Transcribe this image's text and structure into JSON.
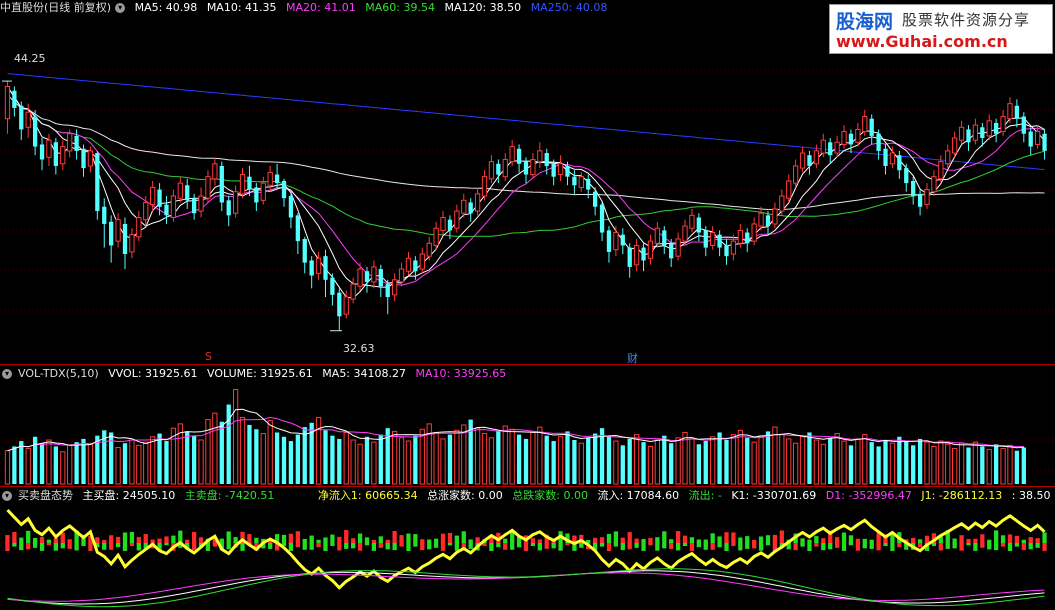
{
  "price_panel": {
    "title": "中直股份(日线 前复权)",
    "ma": [
      {
        "label": "MA5: 40.98",
        "color": "#ffffff"
      },
      {
        "label": "MA10: 41.35",
        "color": "#ffffff"
      },
      {
        "label": "MA20: 41.01",
        "color": "#ff3cff"
      },
      {
        "label": "MA60: 39.54",
        "color": "#33dd33"
      },
      {
        "label": "MA120: 38.50",
        "color": "#ffffff"
      },
      {
        "label": "MA250: 40.08",
        "color": "#3355ff"
      }
    ],
    "high_label": "44.25",
    "low_label": "32.63",
    "marker_s": "S",
    "marker_cai": "财"
  },
  "volume_panel": {
    "title": "VOL-TDX(5,10)",
    "items": [
      {
        "label": "VVOL: 31925.61",
        "color": "#ffffff"
      },
      {
        "label": "VOLUME: 31925.61",
        "color": "#ffffff"
      },
      {
        "label": "MA5: 34108.27",
        "color": "#ffffff"
      },
      {
        "label": "MA10: 33925.65",
        "color": "#ff3cff"
      }
    ]
  },
  "indicator_panel": {
    "title": "买卖盘态势",
    "items": [
      {
        "label": "主买盘: 24505.10",
        "color": "#ffffff"
      },
      {
        "label": "主卖盘: -7420.51",
        "color": "#33dd33"
      },
      {
        "label": "净流入1: 60665.34",
        "color": "#ffff33"
      },
      {
        "label": "总涨家数: 0.00",
        "color": "#ffffff"
      },
      {
        "label": "总跌家数: 0.00",
        "color": "#33dd33"
      },
      {
        "label": "流入: 17084.60",
        "color": "#ffffff"
      },
      {
        "label": "流出: -",
        "color": "#33dd33"
      },
      {
        "label": "K1: -330701.69",
        "color": "#ffffff"
      },
      {
        "label": "D1: -352996.47",
        "color": "#ff3cff"
      },
      {
        "label": "J1: -286112.13",
        "color": "#ffff33"
      },
      {
        "label": ": 38.50",
        "color": "#ffffff"
      }
    ]
  },
  "watermark": {
    "brand": "股海网",
    "slogan": "股票软件资源分享",
    "url": "www.Guhai.com.cn"
  },
  "chart_data": {
    "type": "candlestick",
    "candles": [
      [
        42.5,
        44.0,
        41.8,
        44.25
      ],
      [
        43.8,
        43.0,
        42.6,
        44.0
      ],
      [
        43.1,
        42.0,
        41.5,
        43.3
      ],
      [
        42.1,
        42.8,
        41.6,
        43.2
      ],
      [
        42.6,
        41.2,
        40.8,
        42.9
      ],
      [
        41.3,
        40.6,
        40.1,
        41.6
      ],
      [
        40.7,
        41.5,
        40.3,
        41.8
      ],
      [
        41.4,
        40.3,
        39.9,
        41.6
      ],
      [
        40.4,
        41.2,
        40.1,
        41.5
      ],
      [
        41.0,
        41.8,
        40.7,
        42.0
      ],
      [
        41.7,
        41.0,
        40.6,
        42.0
      ],
      [
        41.1,
        40.2,
        39.8,
        41.3
      ],
      [
        40.3,
        41.0,
        40.0,
        41.2
      ],
      [
        40.9,
        38.2,
        37.8,
        41.0
      ],
      [
        38.4,
        37.6,
        36.5,
        38.8
      ],
      [
        37.7,
        36.6,
        35.8,
        38.0
      ],
      [
        36.8,
        37.8,
        36.5,
        38.1
      ],
      [
        37.6,
        36.2,
        35.5,
        37.9
      ],
      [
        36.3,
        37.1,
        36.0,
        37.4
      ],
      [
        37.0,
        37.9,
        36.8,
        38.2
      ],
      [
        37.8,
        38.6,
        37.5,
        38.9
      ],
      [
        38.5,
        39.3,
        38.2,
        39.6
      ],
      [
        39.2,
        38.4,
        38.0,
        39.5
      ],
      [
        38.5,
        38.0,
        37.6,
        38.9
      ],
      [
        37.9,
        38.9,
        37.7,
        39.2
      ],
      [
        38.8,
        39.5,
        38.6,
        39.8
      ],
      [
        39.4,
        38.7,
        38.3,
        39.7
      ],
      [
        38.8,
        38.1,
        37.8,
        39.0
      ],
      [
        38.2,
        38.9,
        37.9,
        39.3
      ],
      [
        38.8,
        39.8,
        38.6,
        40.1
      ],
      [
        39.7,
        40.4,
        39.4,
        40.7
      ],
      [
        40.3,
        38.6,
        38.2,
        40.5
      ],
      [
        38.7,
        38.0,
        37.5,
        38.9
      ],
      [
        38.1,
        39.1,
        37.9,
        39.4
      ],
      [
        39.0,
        39.9,
        38.8,
        40.2
      ],
      [
        39.8,
        39.2,
        38.9,
        40.3
      ],
      [
        39.3,
        38.6,
        38.2,
        39.5
      ],
      [
        38.7,
        39.5,
        38.5,
        39.8
      ],
      [
        39.4,
        40.0,
        39.1,
        40.3
      ],
      [
        39.9,
        39.5,
        39.2,
        40.4
      ],
      [
        39.6,
        38.8,
        38.4,
        39.7
      ],
      [
        38.9,
        37.9,
        37.4,
        39.0
      ],
      [
        38.0,
        36.8,
        36.2,
        38.1
      ],
      [
        36.9,
        35.8,
        35.3,
        37.0
      ],
      [
        35.9,
        35.2,
        34.6,
        36.1
      ],
      [
        35.3,
        36.0,
        35.0,
        36.3
      ],
      [
        36.1,
        35.0,
        34.2,
        36.4
      ],
      [
        35.1,
        34.3,
        33.8,
        35.3
      ],
      [
        34.4,
        33.3,
        32.63,
        34.6
      ],
      [
        33.4,
        34.2,
        33.2,
        34.5
      ],
      [
        34.1,
        34.8,
        33.9,
        35.1
      ],
      [
        34.7,
        35.5,
        34.5,
        35.8
      ],
      [
        35.4,
        34.9,
        34.4,
        35.6
      ],
      [
        34.9,
        35.6,
        34.6,
        35.9
      ],
      [
        35.5,
        34.7,
        34.2,
        35.7
      ],
      [
        34.8,
        34.2,
        33.4,
        35.0
      ],
      [
        34.3,
        35.0,
        34.0,
        35.3
      ],
      [
        34.9,
        35.5,
        34.7,
        35.8
      ],
      [
        35.4,
        36.0,
        35.2,
        36.3
      ],
      [
        35.9,
        35.4,
        35.0,
        36.1
      ],
      [
        35.5,
        36.2,
        35.3,
        36.5
      ],
      [
        36.1,
        36.7,
        35.9,
        37.0
      ],
      [
        36.6,
        37.4,
        36.4,
        37.7
      ],
      [
        37.3,
        37.9,
        37.1,
        38.2
      ],
      [
        37.8,
        37.3,
        36.9,
        38.0
      ],
      [
        37.4,
        38.2,
        37.2,
        38.5
      ],
      [
        38.1,
        38.7,
        37.9,
        39.0
      ],
      [
        38.6,
        38.1,
        37.7,
        38.8
      ],
      [
        38.2,
        39.0,
        38.0,
        39.3
      ],
      [
        38.9,
        39.8,
        38.7,
        40.1
      ],
      [
        39.7,
        40.5,
        39.5,
        40.8
      ],
      [
        40.4,
        39.9,
        39.5,
        40.6
      ],
      [
        39.8,
        40.6,
        39.6,
        40.9
      ],
      [
        40.5,
        41.2,
        40.3,
        41.5
      ],
      [
        41.1,
        40.4,
        40.0,
        41.3
      ],
      [
        40.5,
        39.9,
        39.5,
        40.7
      ],
      [
        39.9,
        40.6,
        39.7,
        40.9
      ],
      [
        40.5,
        41.0,
        40.2,
        41.4
      ],
      [
        40.9,
        40.3,
        39.9,
        41.1
      ],
      [
        40.4,
        39.8,
        39.4,
        40.6
      ],
      [
        39.9,
        40.4,
        39.6,
        40.8
      ],
      [
        40.3,
        39.8,
        39.4,
        40.5
      ],
      [
        39.8,
        39.4,
        39.0,
        40.1
      ],
      [
        39.3,
        39.8,
        39.1,
        40.0
      ],
      [
        39.7,
        39.2,
        38.8,
        39.9
      ],
      [
        39.1,
        38.4,
        38.0,
        39.3
      ],
      [
        38.5,
        37.2,
        36.8,
        38.6
      ],
      [
        37.3,
        36.3,
        35.8,
        37.5
      ],
      [
        36.4,
        37.2,
        36.1,
        37.5
      ],
      [
        37.1,
        36.6,
        36.2,
        37.4
      ],
      [
        36.5,
        35.6,
        35.1,
        36.7
      ],
      [
        35.7,
        36.6,
        35.4,
        36.9
      ],
      [
        36.5,
        35.9,
        35.4,
        36.7
      ],
      [
        36.0,
        36.8,
        35.7,
        37.1
      ],
      [
        36.7,
        37.4,
        36.5,
        37.7
      ],
      [
        37.3,
        36.6,
        36.2,
        37.5
      ],
      [
        36.7,
        36.0,
        35.6,
        36.9
      ],
      [
        36.1,
        36.9,
        35.9,
        37.2
      ],
      [
        36.8,
        37.5,
        36.6,
        37.8
      ],
      [
        37.4,
        38.0,
        37.2,
        38.3
      ],
      [
        37.9,
        37.2,
        36.8,
        38.1
      ],
      [
        37.3,
        36.5,
        36.1,
        37.5
      ],
      [
        36.6,
        37.2,
        36.4,
        37.5
      ],
      [
        37.1,
        36.5,
        36.1,
        37.3
      ],
      [
        36.6,
        36.1,
        35.7,
        36.9
      ],
      [
        36.2,
        36.8,
        35.9,
        37.1
      ],
      [
        36.7,
        37.3,
        36.5,
        37.6
      ],
      [
        37.2,
        36.7,
        36.3,
        37.4
      ],
      [
        36.8,
        37.6,
        36.6,
        37.9
      ],
      [
        37.5,
        38.1,
        37.3,
        38.4
      ],
      [
        38.0,
        37.5,
        37.1,
        38.2
      ],
      [
        37.6,
        38.3,
        37.4,
        38.6
      ],
      [
        38.2,
        38.9,
        38.0,
        39.2
      ],
      [
        38.8,
        39.6,
        38.6,
        39.9
      ],
      [
        39.5,
        40.3,
        39.3,
        40.6
      ],
      [
        40.2,
        40.9,
        40.0,
        41.2
      ],
      [
        40.8,
        40.3,
        39.9,
        41.0
      ],
      [
        40.4,
        41.0,
        40.2,
        41.3
      ],
      [
        40.9,
        41.5,
        40.7,
        41.8
      ],
      [
        41.4,
        40.8,
        40.4,
        41.6
      ],
      [
        40.9,
        41.4,
        40.7,
        41.7
      ],
      [
        41.3,
        41.9,
        41.1,
        42.2
      ],
      [
        41.8,
        41.3,
        40.9,
        42.0
      ],
      [
        41.4,
        42.0,
        41.2,
        42.3
      ],
      [
        41.9,
        42.6,
        41.7,
        42.9
      ],
      [
        42.5,
        41.7,
        41.3,
        42.7
      ],
      [
        41.8,
        41.0,
        40.6,
        42.0
      ],
      [
        41.1,
        40.3,
        39.9,
        41.3
      ],
      [
        40.4,
        40.9,
        40.2,
        41.2
      ],
      [
        40.8,
        40.1,
        39.7,
        41.0
      ],
      [
        40.2,
        39.5,
        39.1,
        40.4
      ],
      [
        39.6,
        38.9,
        38.5,
        39.8
      ],
      [
        39.0,
        38.4,
        38.0,
        39.2
      ],
      [
        38.5,
        39.2,
        38.3,
        39.5
      ],
      [
        39.1,
        39.8,
        38.9,
        40.1
      ],
      [
        39.7,
        40.5,
        39.5,
        40.8
      ],
      [
        40.4,
        41.0,
        40.2,
        41.3
      ],
      [
        40.9,
        41.6,
        40.7,
        41.9
      ],
      [
        41.5,
        42.1,
        41.3,
        42.4
      ],
      [
        42.0,
        41.4,
        41.0,
        42.2
      ],
      [
        41.5,
        42.2,
        41.3,
        42.5
      ],
      [
        42.1,
        41.6,
        41.2,
        42.3
      ],
      [
        41.7,
        42.4,
        41.5,
        42.7
      ],
      [
        42.3,
        41.8,
        41.4,
        42.5
      ],
      [
        41.9,
        42.6,
        41.7,
        42.9
      ],
      [
        42.5,
        43.2,
        42.3,
        43.5
      ],
      [
        43.1,
        42.5,
        42.1,
        43.4
      ],
      [
        42.6,
        41.8,
        41.4,
        42.8
      ],
      [
        41.9,
        41.2,
        40.8,
        42.1
      ],
      [
        41.3,
        41.9,
        41.1,
        42.2
      ],
      [
        41.8,
        41.0,
        40.6,
        42.0
      ]
    ],
    "ma_lines": [
      "MA5",
      "MA10",
      "MA20",
      "MA60",
      "MA120",
      "MA250"
    ],
    "volume": [
      31,
      35,
      40,
      33,
      44,
      38,
      41,
      35,
      30,
      36,
      39,
      42,
      37,
      45,
      50,
      48,
      34,
      38,
      41,
      36,
      39,
      44,
      47,
      40,
      52,
      56,
      49,
      45,
      41,
      60,
      66,
      58,
      74,
      88,
      62,
      55,
      51,
      47,
      59,
      48,
      44,
      40,
      46,
      53,
      57,
      62,
      50,
      45,
      42,
      48,
      41,
      37,
      44,
      39,
      46,
      52,
      49,
      43,
      40,
      45,
      51,
      56,
      48,
      42,
      46,
      50,
      55,
      60,
      52,
      47,
      43,
      49,
      54,
      51,
      46,
      42,
      48,
      53,
      45,
      40,
      44,
      49,
      41,
      38,
      43,
      47,
      52,
      44,
      40,
      36,
      42,
      46,
      39,
      35,
      41,
      45,
      38,
      43,
      48,
      42,
      37,
      40,
      44,
      48,
      41,
      46,
      50,
      43,
      39,
      45,
      49,
      53,
      46,
      42,
      38,
      44,
      48,
      41,
      37,
      43,
      47,
      40,
      36,
      42,
      46,
      39,
      35,
      41,
      38,
      44,
      40,
      36,
      42,
      39,
      35,
      40,
      37,
      33,
      38,
      34,
      39,
      35,
      32,
      37,
      33,
      36,
      31,
      34
    ]
  }
}
